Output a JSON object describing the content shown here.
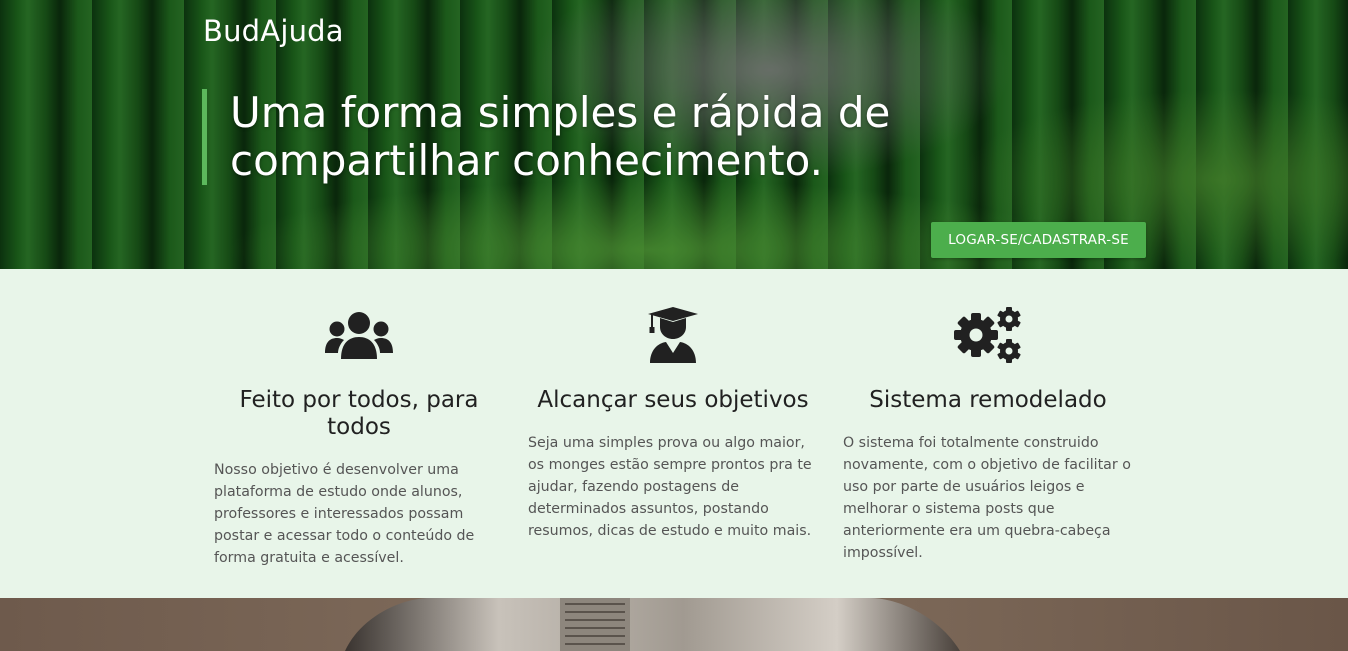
{
  "header": {
    "brand": "BudAjuda",
    "tagline": "Uma forma simples e rápida de compartilhar conhecimento.",
    "cta_label": "LOGAR-SE/CADASTRAR-SE"
  },
  "features": [
    {
      "icon": "users-icon",
      "title": "Feito por todos, para todos",
      "text": "Nosso objetivo é desenvolver uma plataforma de estudo onde alunos, professores e interessados possam postar e acessar todo o conteúdo de forma gratuita e acessível."
    },
    {
      "icon": "graduate-icon",
      "title": "Alcançar seus objetivos",
      "text": "Seja uma simples prova ou algo maior, os monges estão sempre prontos pra te ajudar, fazendo postagens de determinados assuntos, postando resumos, dicas de estudo e muito mais."
    },
    {
      "icon": "gears-icon",
      "title": "Sistema remodelado",
      "text": "O sistema foi totalmente construido novamente, com o objetivo de facilitar o uso por parte de usuários leigos e melhorar o sistema posts que anteriormente era um quebra-cabeça impossível."
    }
  ],
  "colors": {
    "accent": "#4cae4c",
    "features_bg": "#e8f5e9",
    "icon": "#212121"
  }
}
